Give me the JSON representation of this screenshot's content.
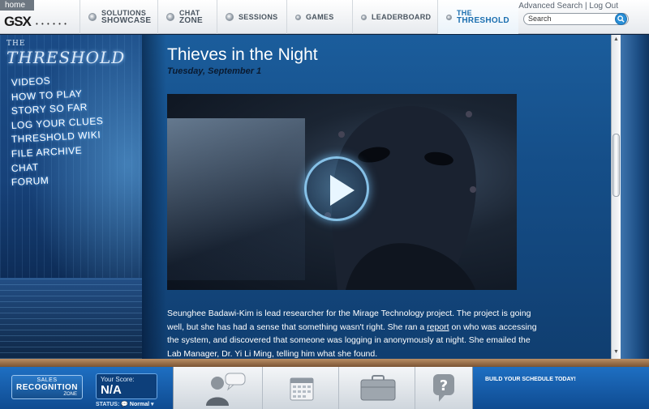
{
  "topbar": {
    "home_label": "home",
    "logo": "GSX",
    "logo_dots": "• • • • • •",
    "links": {
      "advanced_search": "Advanced Search",
      "separator": " | ",
      "log_out": "Log Out"
    },
    "search_placeholder": "Search",
    "nav": [
      {
        "line1": "SOLUTIONS",
        "line2": "SHOWCASE"
      },
      {
        "line1": "CHAT",
        "line2": "ZONE"
      },
      {
        "line1": "",
        "line2": "SESSIONS"
      },
      {
        "line1": "",
        "line2": "GAMES"
      },
      {
        "line1": "",
        "line2": "LEADERBOARD"
      },
      {
        "line1": "THE",
        "line2": "THRESHOLD"
      }
    ]
  },
  "sidebar": {
    "brand_the": "THE",
    "brand_main": "THRESHOLD",
    "menu": [
      "VIDEOS",
      "HOW TO PLAY",
      "STORY SO FAR",
      "LOG YOUR CLUES",
      "THRESHOLD WIKI",
      "FILE ARCHIVE",
      "CHAT",
      "FORUM"
    ]
  },
  "article": {
    "title": "Thieves in the Night",
    "date": "Tuesday, September 1",
    "body_before_link": "Seunghee Badawi-Kim is lead researcher for the Mirage Technology project. The project is going well, but she has had a sense that something wasn't right. She ran a ",
    "link_text": "report",
    "body_after_link": " on who was accessing the system, and discovered that someone was logging in anonymously at night. She emailed the Lab Manager, Dr. Yi Li Ming, telling him what she found."
  },
  "bottombar": {
    "sales_line1": "SALES",
    "sales_line2": "RECOGNITION",
    "sales_line3": "ZONE",
    "score_label": "Your Score:",
    "score_value": "N/A",
    "status_label": "STATUS:",
    "status_value": "Normal",
    "build_schedule": "BUILD YOUR SCHEDULE TODAY!"
  },
  "colors": {
    "accent": "#1b6fb0",
    "panel_blue": "#154e88",
    "bottom_blue": "#1e6fc2"
  }
}
